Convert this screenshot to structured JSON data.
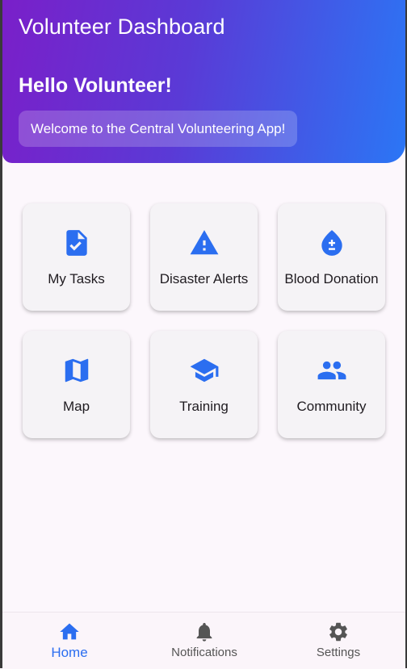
{
  "header": {
    "app_title": "Volunteer Dashboard",
    "greeting": "Hello Volunteer!",
    "welcome_message": "Welcome to the Central Volunteering App!",
    "gradient_colors": [
      "#7a1fc9",
      "#2b76f5"
    ]
  },
  "tiles": [
    {
      "label": "My Tasks",
      "icon": "task-document-icon"
    },
    {
      "label": "Disaster Alerts",
      "icon": "warning-icon"
    },
    {
      "label": "Blood Donation",
      "icon": "blood-drop-icon"
    },
    {
      "label": "Map",
      "icon": "map-icon"
    },
    {
      "label": "Training",
      "icon": "graduation-cap-icon"
    },
    {
      "label": "Community",
      "icon": "people-icon"
    }
  ],
  "bottom_nav": {
    "items": [
      {
        "label": "Home",
        "icon": "home-icon",
        "active": true
      },
      {
        "label": "Notifications",
        "icon": "bell-icon",
        "active": false
      },
      {
        "label": "Settings",
        "icon": "gear-icon",
        "active": false
      }
    ]
  },
  "colors": {
    "accent": "#2b6ef0",
    "inactive_icon": "#555555",
    "background": "#fcf7fc"
  }
}
